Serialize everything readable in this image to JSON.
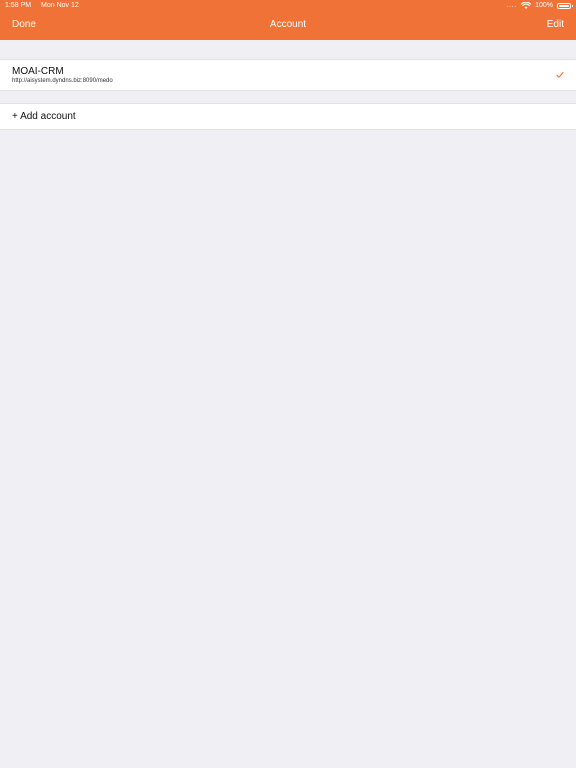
{
  "status_bar": {
    "time": "1:58 PM",
    "date": "Mon Nov 12",
    "signal": "....",
    "battery_text": "100%"
  },
  "nav": {
    "done_label": "Done",
    "title": "Account",
    "edit_label": "Edit"
  },
  "accounts": [
    {
      "name": "MOAI-CRM",
      "url": "http://aisystem.dyndns.biz:8090/medo",
      "selected": true
    }
  ],
  "add_account_label": "+ Add account",
  "colors": {
    "accent": "#f07236",
    "background": "#efeff4",
    "check": "#f07236"
  },
  "icons": {
    "wifi": "wifi-icon",
    "battery": "battery-icon",
    "selected": "checkmark-icon"
  }
}
